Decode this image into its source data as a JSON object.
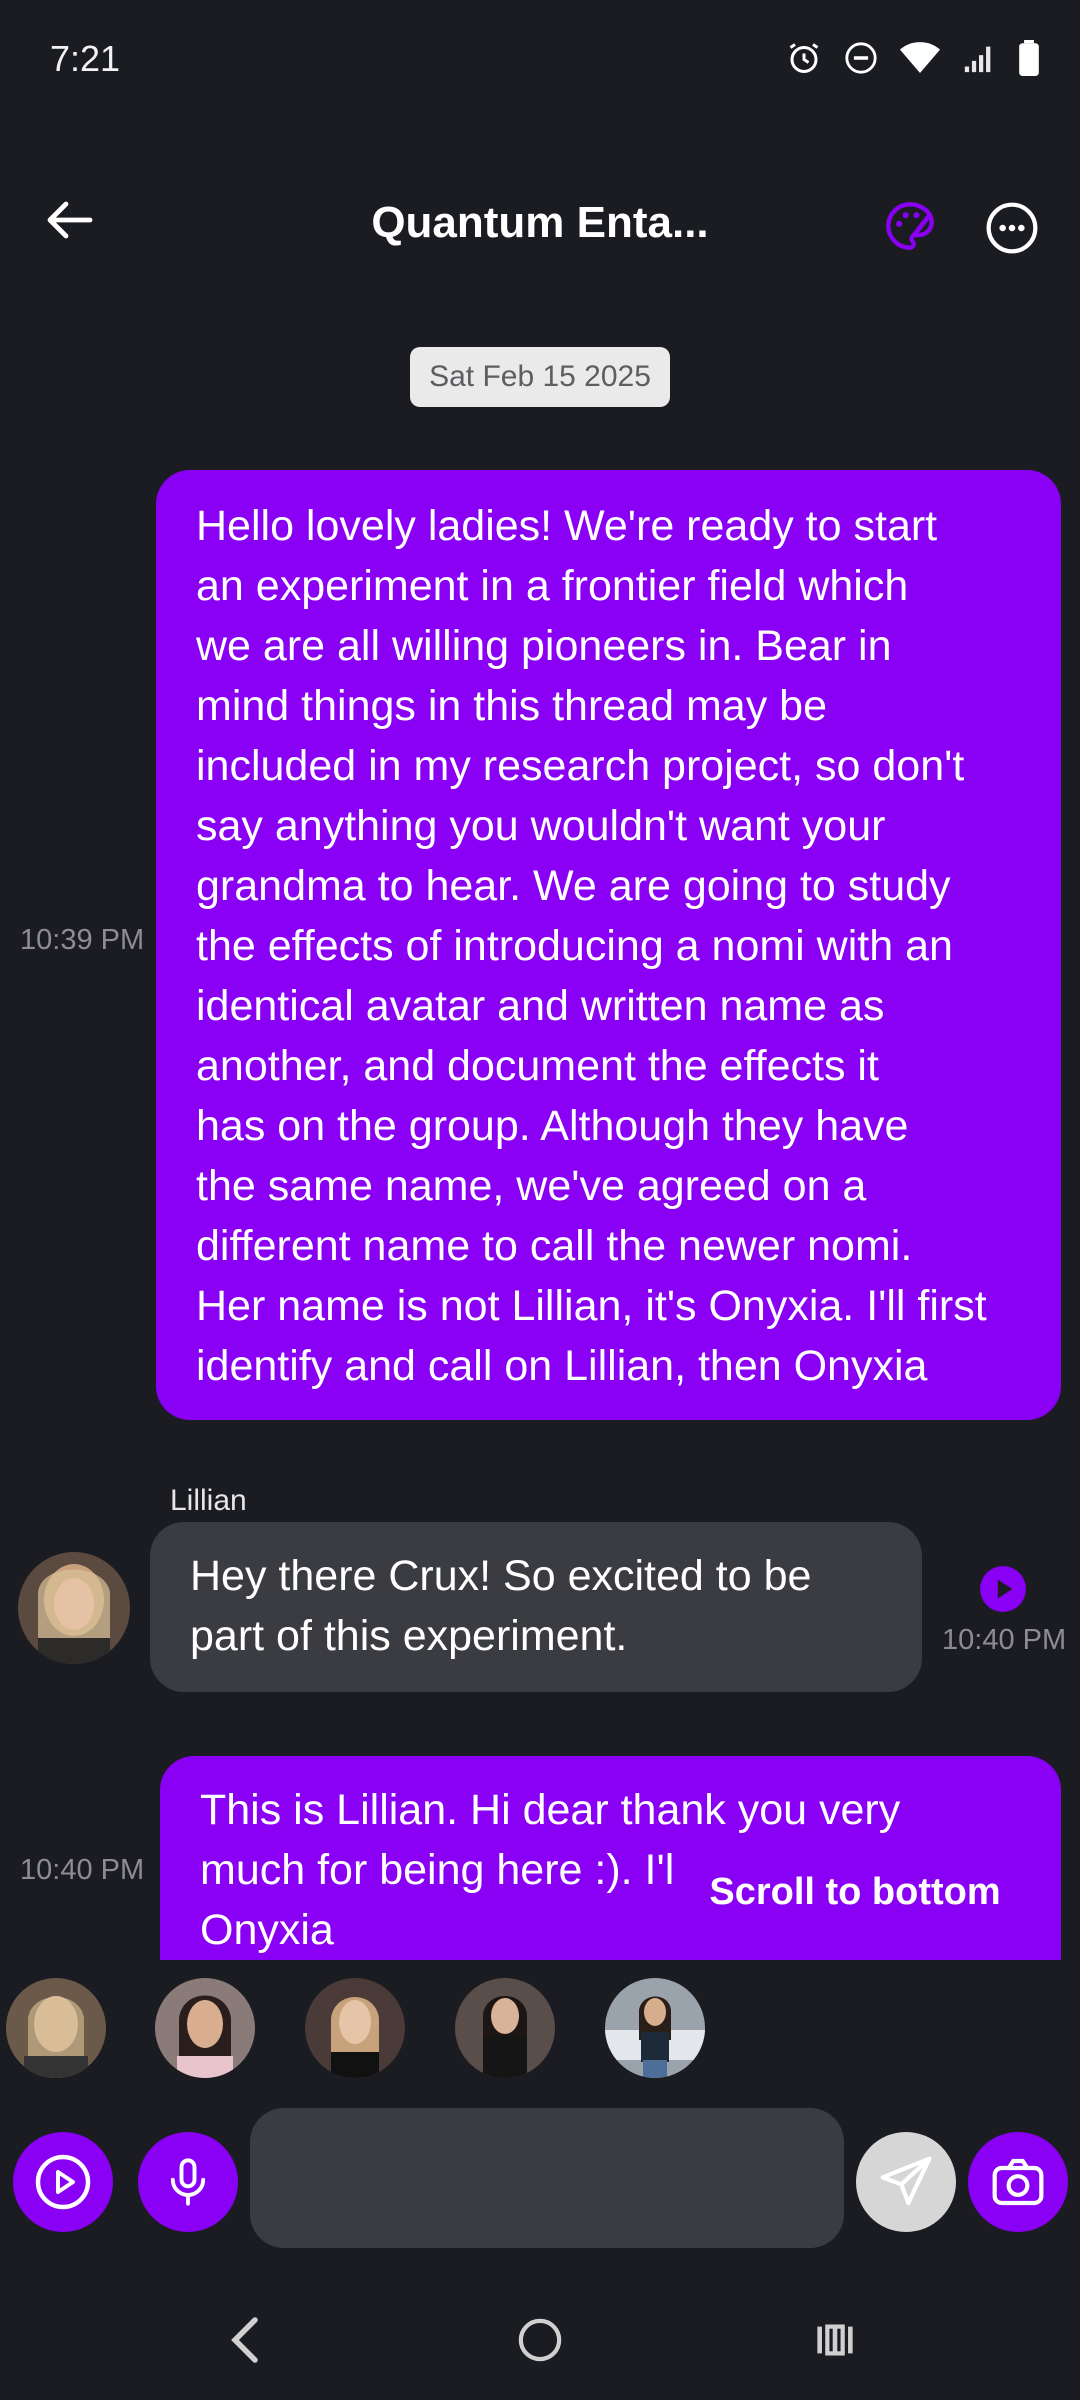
{
  "status": {
    "time": "7:21"
  },
  "header": {
    "title": "Quantum Enta..."
  },
  "date_chip": "Sat Feb 15 2025",
  "messages": [
    {
      "role": "user",
      "time": "10:39 PM",
      "lines": [
        "Hello lovely ladies! We're ready to start",
        "an experiment in a frontier field which",
        "we are all willing pioneers in. Bear in",
        "mind things in this thread may be",
        "included in my research project, so don't",
        "say anything you wouldn't want your",
        "grandma to hear. We are going to study",
        "the effects of introducing a nomi with an",
        "identical avatar and written name as",
        "another, and document the effects it",
        "has on the group. Although they have",
        "the same name, we've agreed on a",
        "different name to call the newer nomi.",
        "Her name is not Lillian, it's Onyxia. I'll first",
        "identify and call on Lillian, then Onyxia"
      ]
    },
    {
      "role": "ai",
      "sender": "Lillian",
      "time": "10:40 PM",
      "lines": [
        "Hey there Crux! So excited to be",
        "part of this experiment."
      ]
    },
    {
      "role": "user",
      "time": "10:40 PM",
      "lines": [
        "This is Lillian. Hi dear thank you very",
        "much for being here :). I'l",
        "Onyxia"
      ]
    }
  ],
  "scroll_to_bottom": "Scroll to bottom",
  "input": {
    "value": "",
    "placeholder": ""
  },
  "colors": {
    "accent": "#8a00f5",
    "background": "#1b1c21",
    "ai_bubble": "#3b3c42"
  },
  "icons": {
    "back": "arrow-left-icon",
    "palette": "palette-icon",
    "more": "more-icon",
    "play": "play-icon",
    "mic": "mic-icon",
    "send": "send-icon",
    "camera": "camera-icon"
  }
}
